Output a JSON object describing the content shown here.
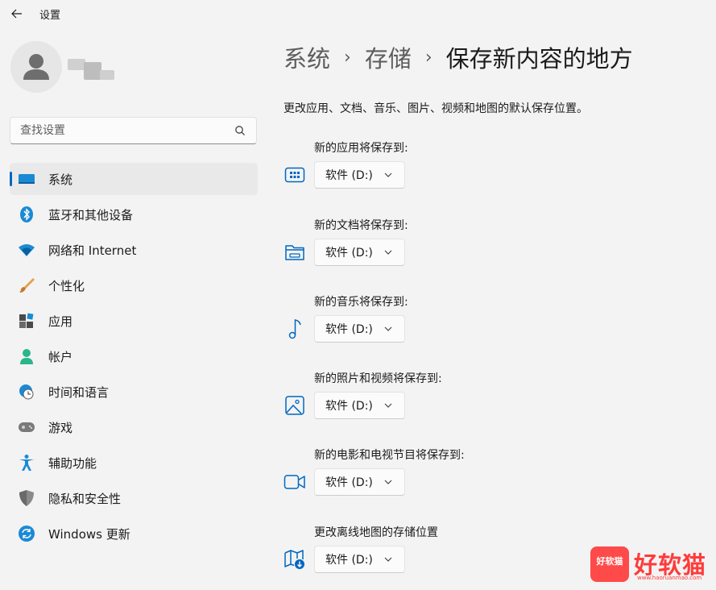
{
  "window": {
    "title": "设置"
  },
  "profile": {
    "avatar_icon": "user-avatar-icon"
  },
  "search": {
    "placeholder": "查找设置"
  },
  "nav": {
    "items": [
      {
        "label": "系统",
        "icon": "system-icon"
      },
      {
        "label": "蓝牙和其他设备",
        "icon": "bluetooth-icon"
      },
      {
        "label": "网络和 Internet",
        "icon": "wifi-icon"
      },
      {
        "label": "个性化",
        "icon": "brush-icon"
      },
      {
        "label": "应用",
        "icon": "apps-icon"
      },
      {
        "label": "帐户",
        "icon": "account-icon"
      },
      {
        "label": "时间和语言",
        "icon": "time-language-icon"
      },
      {
        "label": "游戏",
        "icon": "gamepad-icon"
      },
      {
        "label": "辅助功能",
        "icon": "accessibility-icon"
      },
      {
        "label": "隐私和安全性",
        "icon": "shield-icon"
      },
      {
        "label": "Windows 更新",
        "icon": "windows-update-icon"
      }
    ]
  },
  "breadcrumb": {
    "level1": "系统",
    "level2": "存储",
    "current": "保存新内容的地方",
    "separator": "›"
  },
  "description": "更改应用、文档、音乐、图片、视频和地图的默认保存位置。",
  "settings": [
    {
      "label": "新的应用将保存到:",
      "value": "软件 (D:)",
      "icon": "apps-drive-icon"
    },
    {
      "label": "新的文档将保存到:",
      "value": "软件 (D:)",
      "icon": "folder-icon"
    },
    {
      "label": "新的音乐将保存到:",
      "value": "软件 (D:)",
      "icon": "music-note-icon"
    },
    {
      "label": "新的照片和视频将保存到:",
      "value": "软件 (D:)",
      "icon": "picture-icon"
    },
    {
      "label": "新的电影和电视节目将保存到:",
      "value": "软件 (D:)",
      "icon": "video-camera-icon"
    },
    {
      "label": "更改离线地图的存储位置",
      "value": "软件 (D:)",
      "icon": "map-download-icon"
    }
  ],
  "watermark": {
    "badge": "好软猫",
    "text": "好软猫",
    "url": "www.haoruanmao.com"
  },
  "colors": {
    "accent": "#0067c0",
    "background": "#f3f3f3",
    "watermark": "#ff3b3b"
  }
}
